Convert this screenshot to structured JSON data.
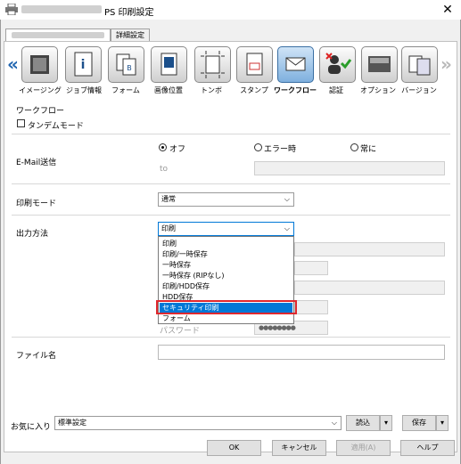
{
  "window": {
    "title_suffix": "PS 印刷設定",
    "close_glyph": "✕"
  },
  "tabs": {
    "tab1": "",
    "tab2": "詳細設定"
  },
  "toolbar": {
    "items": [
      {
        "label": "イメージング"
      },
      {
        "label": "ジョブ情報"
      },
      {
        "label": "フォーム"
      },
      {
        "label": "画像位置"
      },
      {
        "label": "トンボ"
      },
      {
        "label": "スタンプ"
      },
      {
        "label": "ワークフロー"
      },
      {
        "label": "認証"
      },
      {
        "label": "オプション"
      },
      {
        "label": "バージョン"
      }
    ],
    "left_arrow": "«",
    "right_arrow": "»"
  },
  "section": {
    "title": "ワークフロー",
    "tandem_label": "タンデムモード"
  },
  "email": {
    "label": "E-Mail送信",
    "radio_off": "オフ",
    "radio_error": "エラー時",
    "radio_always": "常に",
    "to_label": "to"
  },
  "print_mode": {
    "label": "印刷モード",
    "value": "通常"
  },
  "output": {
    "label": "出力方法",
    "value": "印刷",
    "options": [
      "印刷",
      "印刷/一時保存",
      "一時保存",
      "一時保存 (RIPなし)",
      "印刷/HDD保存",
      "HDD保存",
      "セキュリティ印刷",
      "フォーム"
    ],
    "selected_option": "セキュリティ印刷",
    "password_label": "パスワード",
    "password_mask": "●●●●●●●●"
  },
  "filename": {
    "label": "ファイル名"
  },
  "favorites": {
    "label": "お気に入り",
    "value": "標準設定",
    "load_label": "読込",
    "save_label": "保存"
  },
  "buttons": {
    "ok": "OK",
    "cancel": "キャンセル",
    "apply": "適用(A)",
    "help": "ヘルプ"
  },
  "colors": {
    "accent": "#0078d7",
    "highlight_red": "#e0282e",
    "active_icon": "#7fb0de"
  }
}
